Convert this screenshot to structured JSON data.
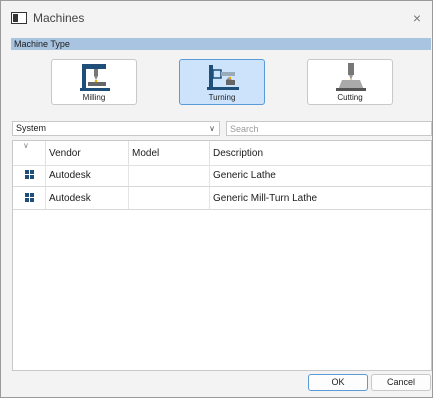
{
  "window": {
    "title": "Machines",
    "close_label": "×"
  },
  "section": {
    "machine_type_label": "Machine Type"
  },
  "machine_types": [
    {
      "label": "Milling",
      "selected": false,
      "icon": "milling-machine-icon"
    },
    {
      "label": "Turning",
      "selected": true,
      "icon": "turning-lathe-icon"
    },
    {
      "label": "Cutting",
      "selected": false,
      "icon": "cutting-machine-icon"
    }
  ],
  "filter": {
    "system_value": "System",
    "search_placeholder": "Search"
  },
  "table": {
    "columns": [
      "Vendor",
      "Model",
      "Description"
    ],
    "rows": [
      {
        "vendor": "Autodesk",
        "model": "",
        "description": "Generic Lathe",
        "icon": "machine-grid-icon"
      },
      {
        "vendor": "Autodesk",
        "model": "",
        "description": "Generic Mill-Turn Lathe",
        "icon": "machine-grid-icon"
      }
    ]
  },
  "buttons": {
    "ok": "OK",
    "cancel": "Cancel"
  },
  "colors": {
    "accent": "#5b9bd5",
    "selected_bg": "#cde3fb",
    "header_band": "#a9c4e0",
    "row_icon": "#1f4e79"
  }
}
